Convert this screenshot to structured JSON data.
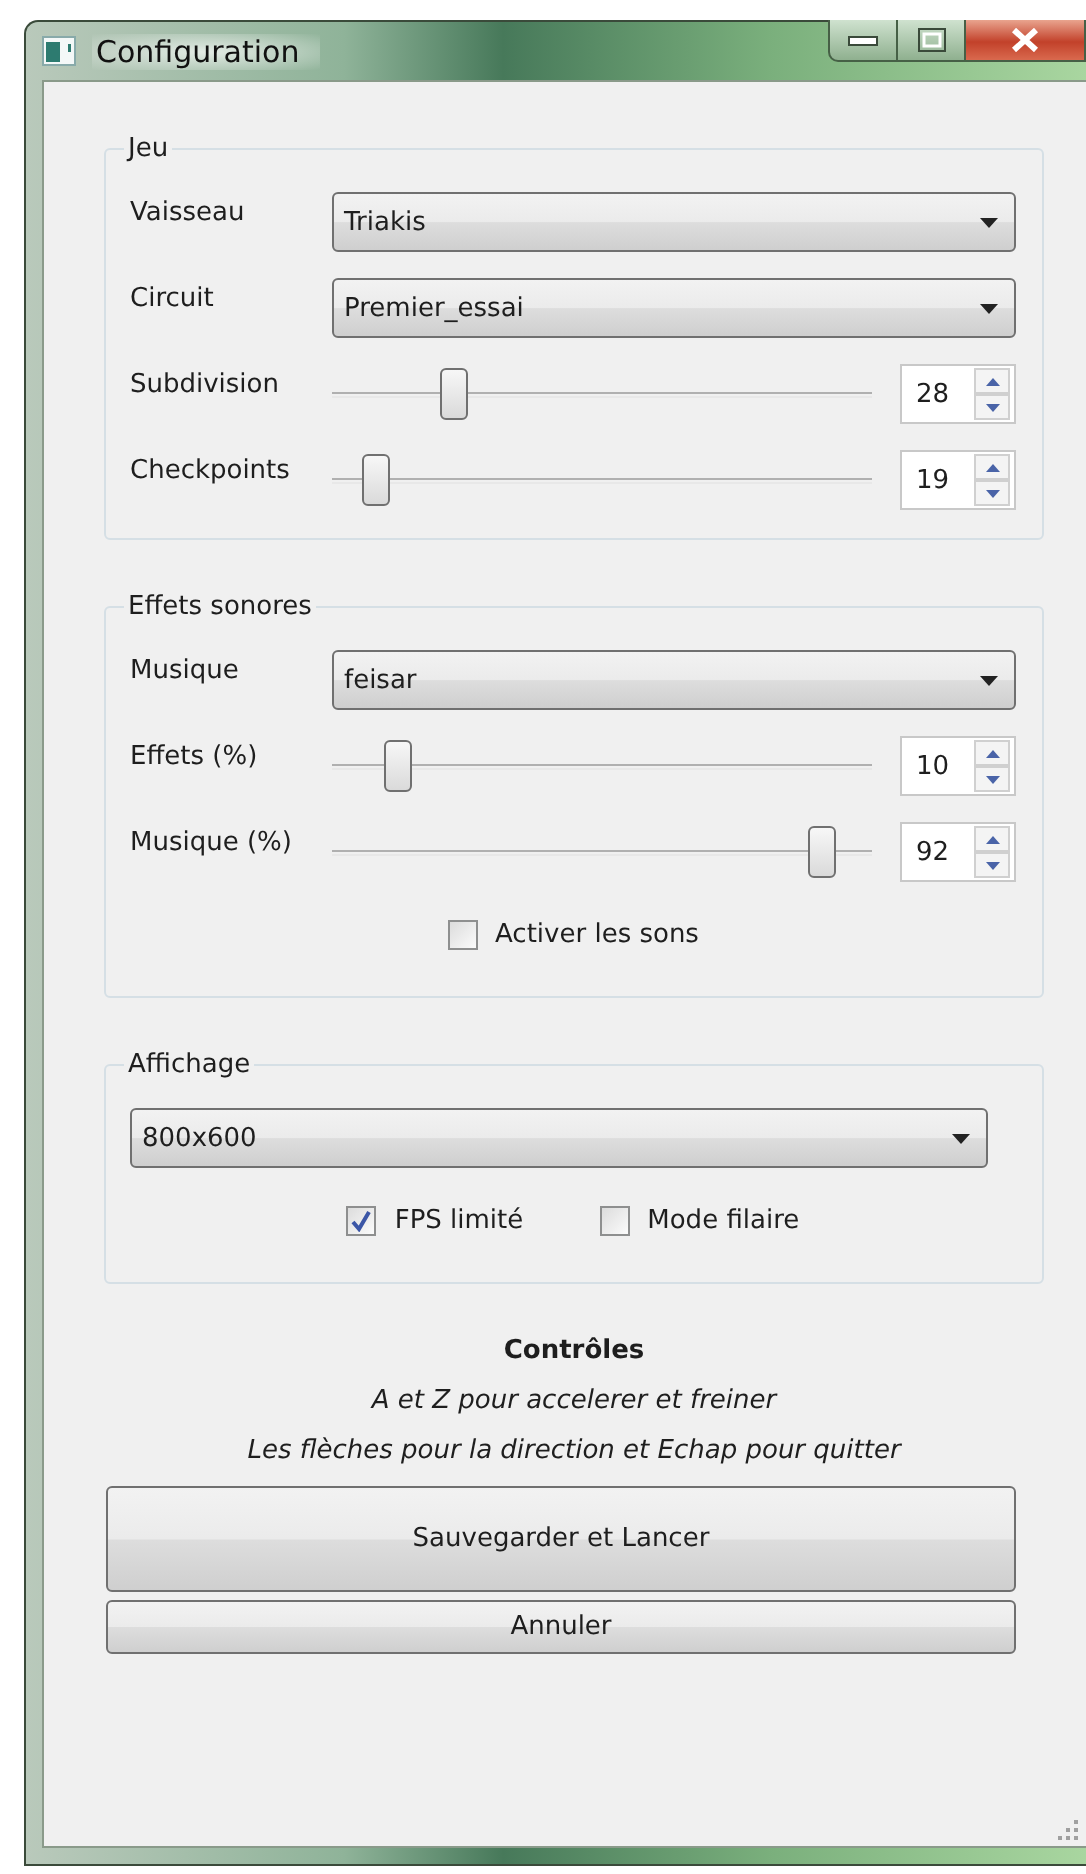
{
  "window": {
    "title": "Configuration"
  },
  "groups": [
    {
      "title": "Jeu",
      "rows": [
        {
          "kind": "combo",
          "label": "Vaisseau",
          "value": "Triakis"
        },
        {
          "kind": "combo",
          "label": "Circuit",
          "value": "Premier_essai"
        },
        {
          "kind": "slider",
          "label": "Subdivision",
          "level": 0.21,
          "value": "28"
        },
        {
          "kind": "slider",
          "label": "Checkpoints",
          "level": 0.06,
          "value": "19"
        }
      ]
    },
    {
      "title": "Effets sonores",
      "rows": [
        {
          "kind": "combo",
          "label": "Musique",
          "value": "feisar"
        },
        {
          "kind": "slider",
          "label": "Effets (%)",
          "level": 0.1,
          "value": "10"
        },
        {
          "kind": "slider",
          "label": "Musique (%)",
          "level": 0.93,
          "value": "92"
        },
        {
          "kind": "checks",
          "items": [
            {
              "label": "Activer les sons",
              "checked": false
            }
          ]
        }
      ]
    },
    {
      "title": "Affichage",
      "rows": [
        {
          "kind": "wide_combo",
          "value": "800x600"
        },
        {
          "kind": "checks",
          "items": [
            {
              "label": "FPS limité",
              "checked": true
            },
            {
              "label": "Mode filaire",
              "checked": false
            }
          ]
        }
      ]
    }
  ],
  "controls": {
    "title": "Contrôles",
    "lines": [
      "A et Z pour accelerer et freiner",
      "Les flèches pour la direction et Echap pour quitter"
    ]
  },
  "buttons": [
    {
      "kind": "primary",
      "label": "Sauvegarder et Lancer"
    },
    {
      "kind": "secondary",
      "label": "Annuler"
    }
  ]
}
